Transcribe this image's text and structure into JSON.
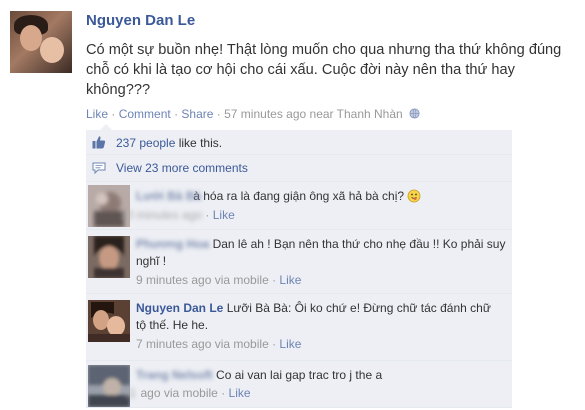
{
  "post": {
    "author": "Nguyen Dan Le",
    "text": "Có một sự buồn nhẹ! Thật lòng muốn cho qua nhưng tha thứ không đúng chỗ có khi là tạo cơ hội cho cái xấu. Cuộc đời này nên tha thứ hay không???",
    "actions": {
      "like": "Like",
      "comment": "Comment",
      "share": "Share",
      "separator": "·",
      "timestamp": "57 minutes ago near Thanh Nhàn"
    }
  },
  "likes": {
    "count_link": "237 people",
    "suffix": " like this."
  },
  "view_more": "View 23 more comments",
  "comments": [
    {
      "author": "Lưới Bà Bà",
      "text": "à hóa ra là đang giận ông xã hả bà chị?",
      "emoji": "tongue-emoji",
      "time": "10 minutes ago",
      "like": "Like"
    },
    {
      "author": "Phương Hoa",
      "text": "Dan lê ah ! Bạn nên tha thứ cho nhẹ đầu !! Ko phải suy nghĩ !",
      "time": "9 minutes ago via mobile",
      "like": "Like"
    },
    {
      "author": "Nguyen Dan Le",
      "text": "Lưỡi Bà Bà: Ôi ko chứ e! Đừng chữ tác đánh chữ tộ thế. He he.",
      "time": "7 minutes ago via mobile",
      "like": "Like"
    },
    {
      "author": "Trang Nelsoft",
      "text": "Co ai van lai gap trac tro j the a",
      "time_hidden": "11",
      "time": "ago via mobile",
      "like": "Like"
    }
  ],
  "colors": {
    "link": "#3b5998",
    "ufi_bg": "#edeff4",
    "meta": "#999999"
  }
}
